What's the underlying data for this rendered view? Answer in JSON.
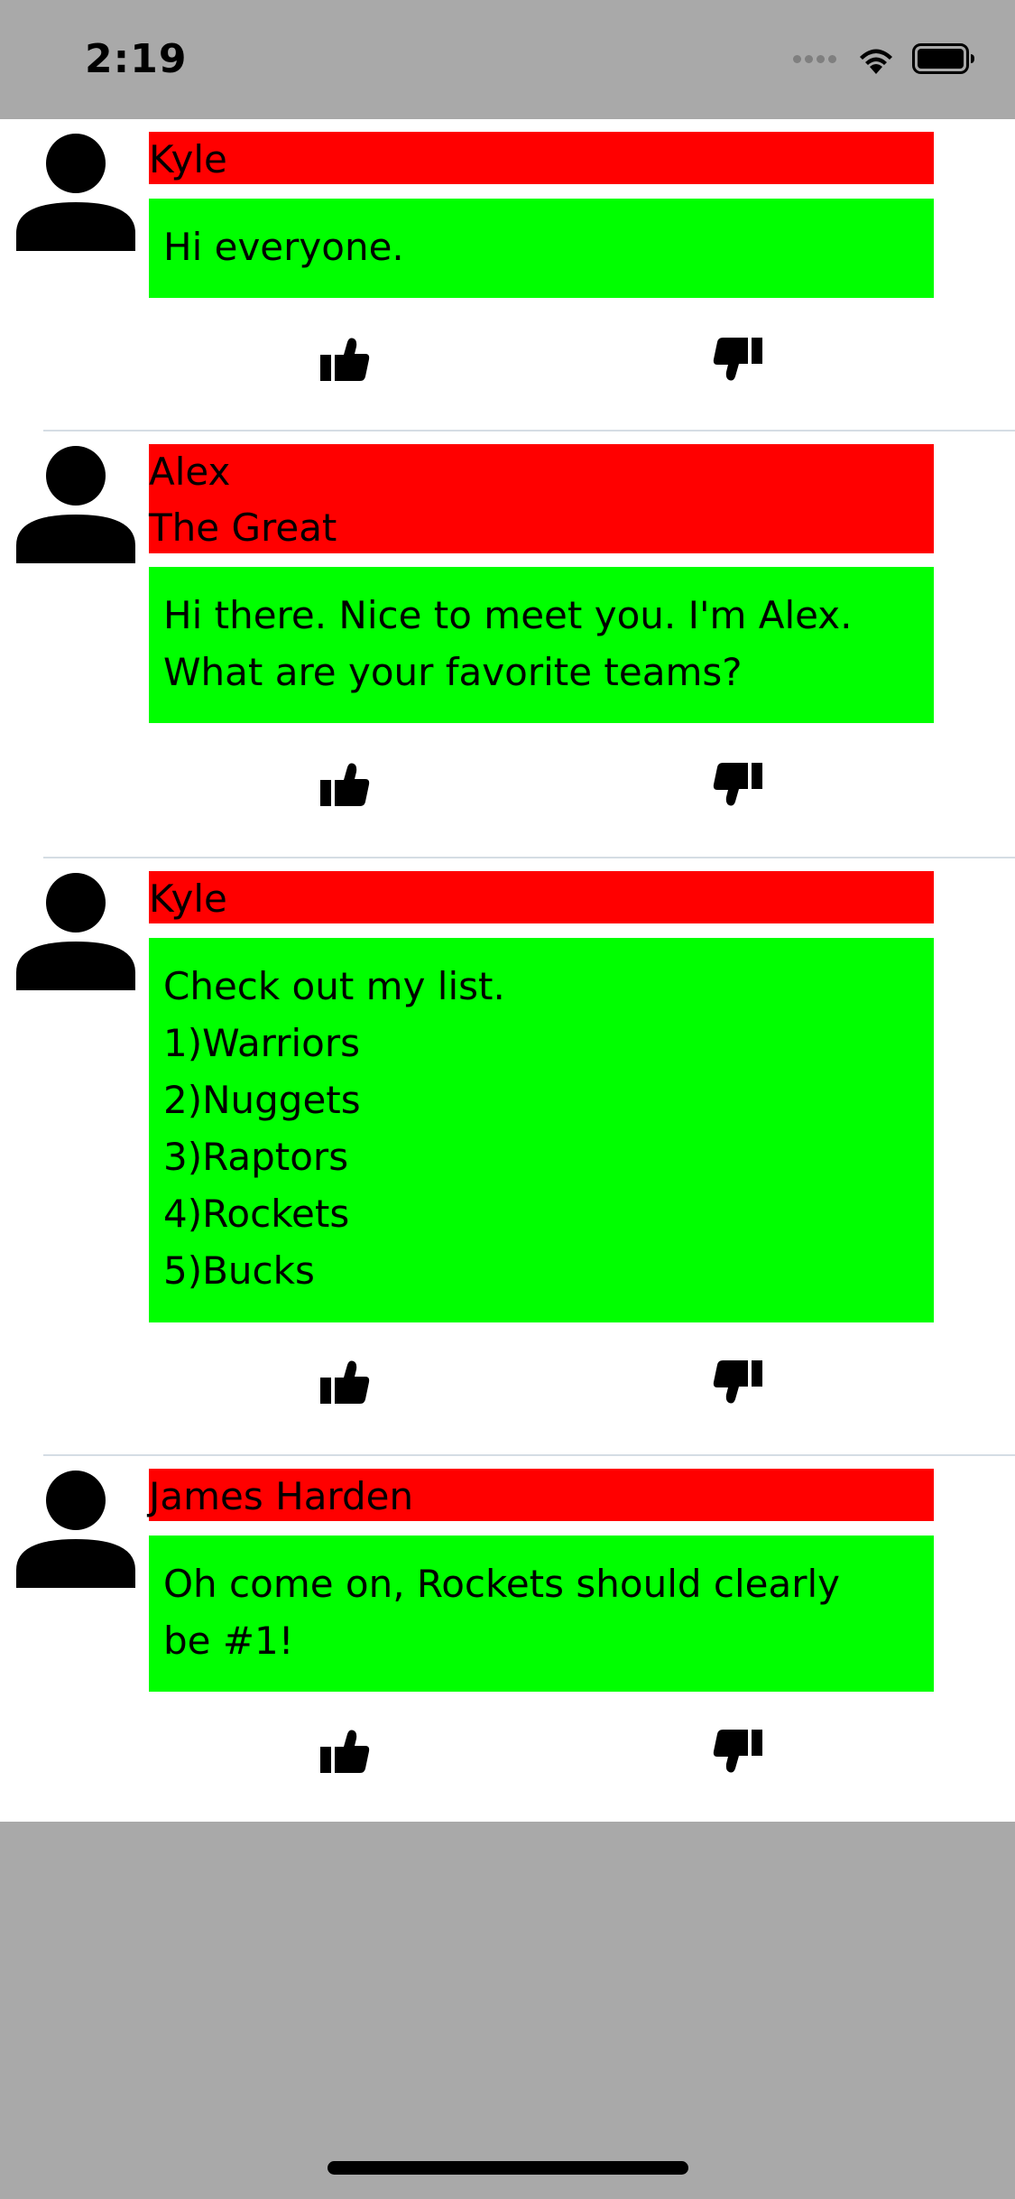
{
  "status_bar": {
    "time": "2:19"
  },
  "colors": {
    "background": "#a9a9a9",
    "name_background": "#ff0000",
    "message_background": "#00ff00",
    "separator": "#d5dde4"
  },
  "icons": {
    "avatar": "person-icon",
    "like": "thumbs-up-icon",
    "dislike": "thumbs-down-icon"
  },
  "posts": [
    {
      "name": "Kyle",
      "message": "Hi everyone."
    },
    {
      "name": "Alex\nThe Great",
      "message": "Hi there. Nice to meet you. I'm Alex.\nWhat are your favorite teams?"
    },
    {
      "name": "Kyle",
      "message": "Check out my list.\n1)Warriors\n2)Nuggets\n3)Raptors\n4)Rockets\n5)Bucks"
    },
    {
      "name": "James Harden",
      "message": "Oh come on, Rockets should clearly\nbe #1!"
    }
  ]
}
